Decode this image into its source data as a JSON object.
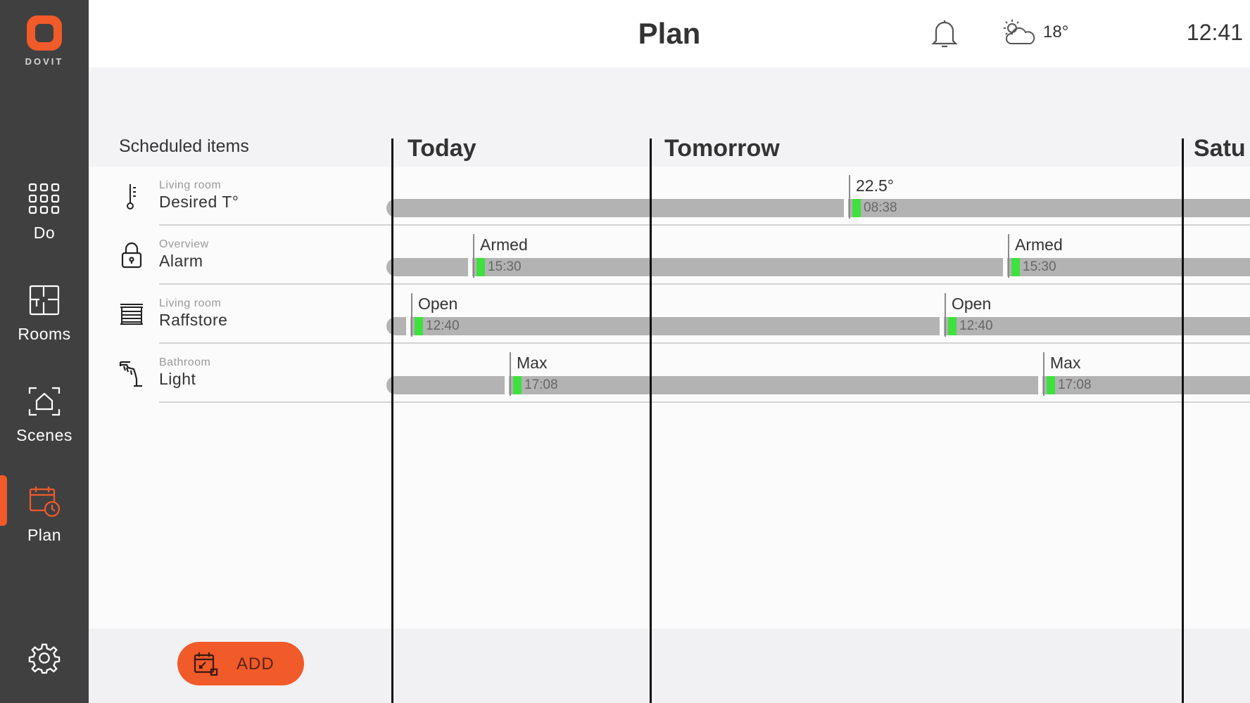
{
  "app": {
    "brand": "DOVIT",
    "accent_color": "#f15a29",
    "sidebar_color": "#404040",
    "active_marker_color": "#3ee13e"
  },
  "header": {
    "title": "Plan",
    "notification_icon": "bell-icon",
    "weather_icon": "partly-cloudy-icon",
    "temperature": "18°",
    "time": "12:41"
  },
  "sidebar": {
    "items": [
      {
        "label": "Do",
        "icon": "grid-icon"
      },
      {
        "label": "Rooms",
        "icon": "floorplan-icon"
      },
      {
        "label": "Scenes",
        "icon": "house-scene-icon"
      },
      {
        "label": "Plan",
        "icon": "calendar-clock-icon",
        "active": true
      }
    ],
    "settings_icon": "gear-icon"
  },
  "schedule": {
    "title": "Scheduled items",
    "days": [
      "Today",
      "Tomorrow",
      "Satu"
    ],
    "rows": [
      {
        "room": "Living room",
        "name": "Desired T°",
        "icon": "thermometer-icon",
        "events": [
          {
            "value": "22.5°",
            "time": "08:38"
          }
        ]
      },
      {
        "room": "Overview",
        "name": "Alarm",
        "icon": "lock-icon",
        "events": [
          {
            "value": "Armed",
            "time": "15:30"
          },
          {
            "value": "Armed",
            "time": "15:30"
          }
        ]
      },
      {
        "room": "Living room",
        "name": "Raffstore",
        "icon": "blinds-icon",
        "events": [
          {
            "value": "Open",
            "time": "12:40"
          },
          {
            "value": "Open",
            "time": "12:40"
          }
        ]
      },
      {
        "room": "Bathroom",
        "name": "Light",
        "icon": "ceiling-lamp-icon",
        "events": [
          {
            "value": "Max",
            "time": "17:08"
          },
          {
            "value": "Max",
            "time": "17:08"
          }
        ]
      }
    ]
  },
  "footer": {
    "add_label": "ADD",
    "add_icon": "calendar-add-icon"
  }
}
